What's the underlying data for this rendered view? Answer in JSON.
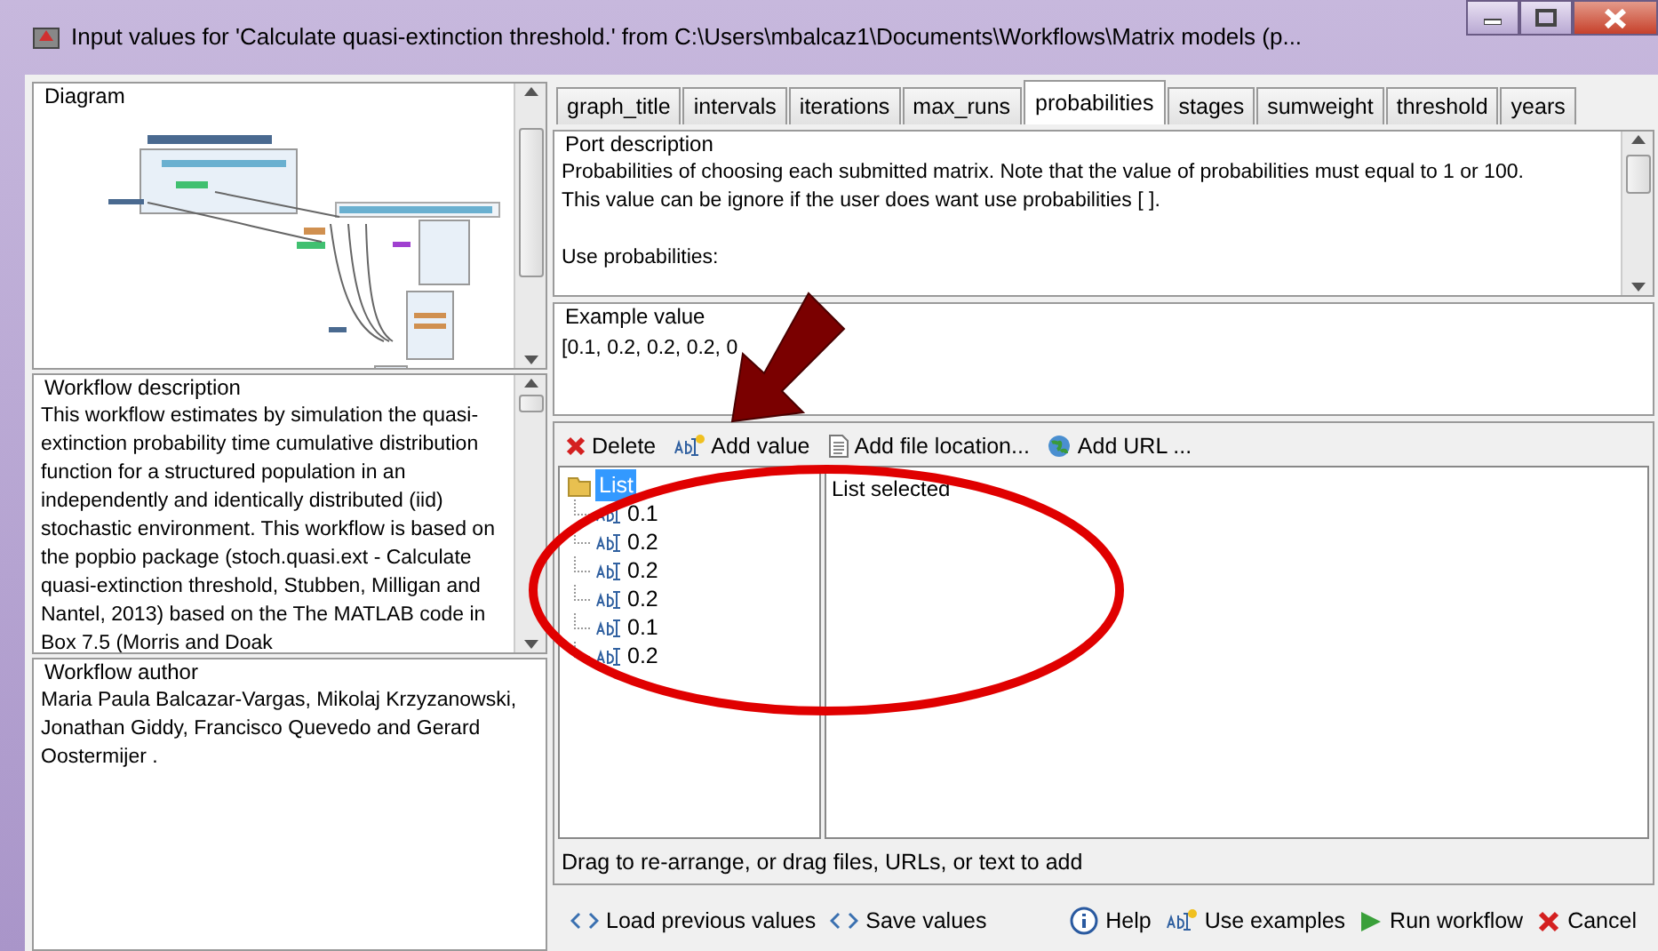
{
  "window": {
    "title": "Input values for 'Calculate quasi-extinction threshold.' from C:\\Users\\mbalcaz1\\Documents\\Workflows\\Matrix models (p..."
  },
  "diagram": {
    "title": "Diagram"
  },
  "description": {
    "title": "Workflow description",
    "text": "This workflow estimates by simulation the quasi-extinction probability time cumulative distribution function for a structured population in an independently and identically distributed (iid) stochastic environment. This workflow is based on the popbio package (stoch.quasi.ext - Calculate quasi-extinction threshold, Stubben, Milligan and Nantel, 2013) based on the The MATLAB code in Box 7.5 (Morris and Doak"
  },
  "author": {
    "title": "Workflow author",
    "text": "Maria Paula Balcazar-Vargas, Mikolaj Krzyzanowski, Jonathan Giddy, Francisco Quevedo and Gerard Oostermijer ."
  },
  "tabs": [
    {
      "label": "graph_title",
      "selected": false
    },
    {
      "label": "intervals",
      "selected": false
    },
    {
      "label": "iterations",
      "selected": false
    },
    {
      "label": "max_runs",
      "selected": false
    },
    {
      "label": "probabilities",
      "selected": true
    },
    {
      "label": "stages",
      "selected": false
    },
    {
      "label": "sumweight",
      "selected": false
    },
    {
      "label": "threshold",
      "selected": false
    },
    {
      "label": "years",
      "selected": false
    }
  ],
  "port_description": {
    "title": "Port description",
    "paragraphs": [
      "Probabilities of choosing each submitted matrix. Note that the value of probabilities must equal to 1 or 100.",
      "This value can be ignore if the user does want use probabilities [ ].",
      "Use probabilities:"
    ]
  },
  "example": {
    "title": "Example value",
    "value": "[0.1, 0.2, 0.2, 0.2, 0"
  },
  "toolbar": [
    {
      "label": "Delete",
      "kind": "delete"
    },
    {
      "label": "Add value",
      "kind": "value"
    },
    {
      "label": "Add file location...",
      "kind": "file"
    },
    {
      "label": "Add URL ...",
      "kind": "url"
    }
  ],
  "tree": {
    "label": "List",
    "selected": true,
    "children": [
      {
        "label": "0.1",
        "selected": false
      },
      {
        "label": "0.2",
        "selected": false
      },
      {
        "label": "0.2",
        "selected": false
      },
      {
        "label": "0.2",
        "selected": false
      },
      {
        "label": "0.1",
        "selected": false
      },
      {
        "label": "0.2",
        "selected": false
      }
    ]
  },
  "detail": "List selected",
  "hint": "Drag to re-arrange, or drag files, URLs, or text to add",
  "footer_left": [
    {
      "label": "Load previous values",
      "kind": "code"
    },
    {
      "label": "Save values",
      "kind": "code"
    }
  ],
  "footer_right": [
    {
      "label": "Help",
      "kind": "info"
    },
    {
      "label": "Use examples",
      "kind": "value"
    },
    {
      "label": "Run workflow",
      "kind": "run"
    },
    {
      "label": "Cancel",
      "kind": "cancel"
    }
  ]
}
